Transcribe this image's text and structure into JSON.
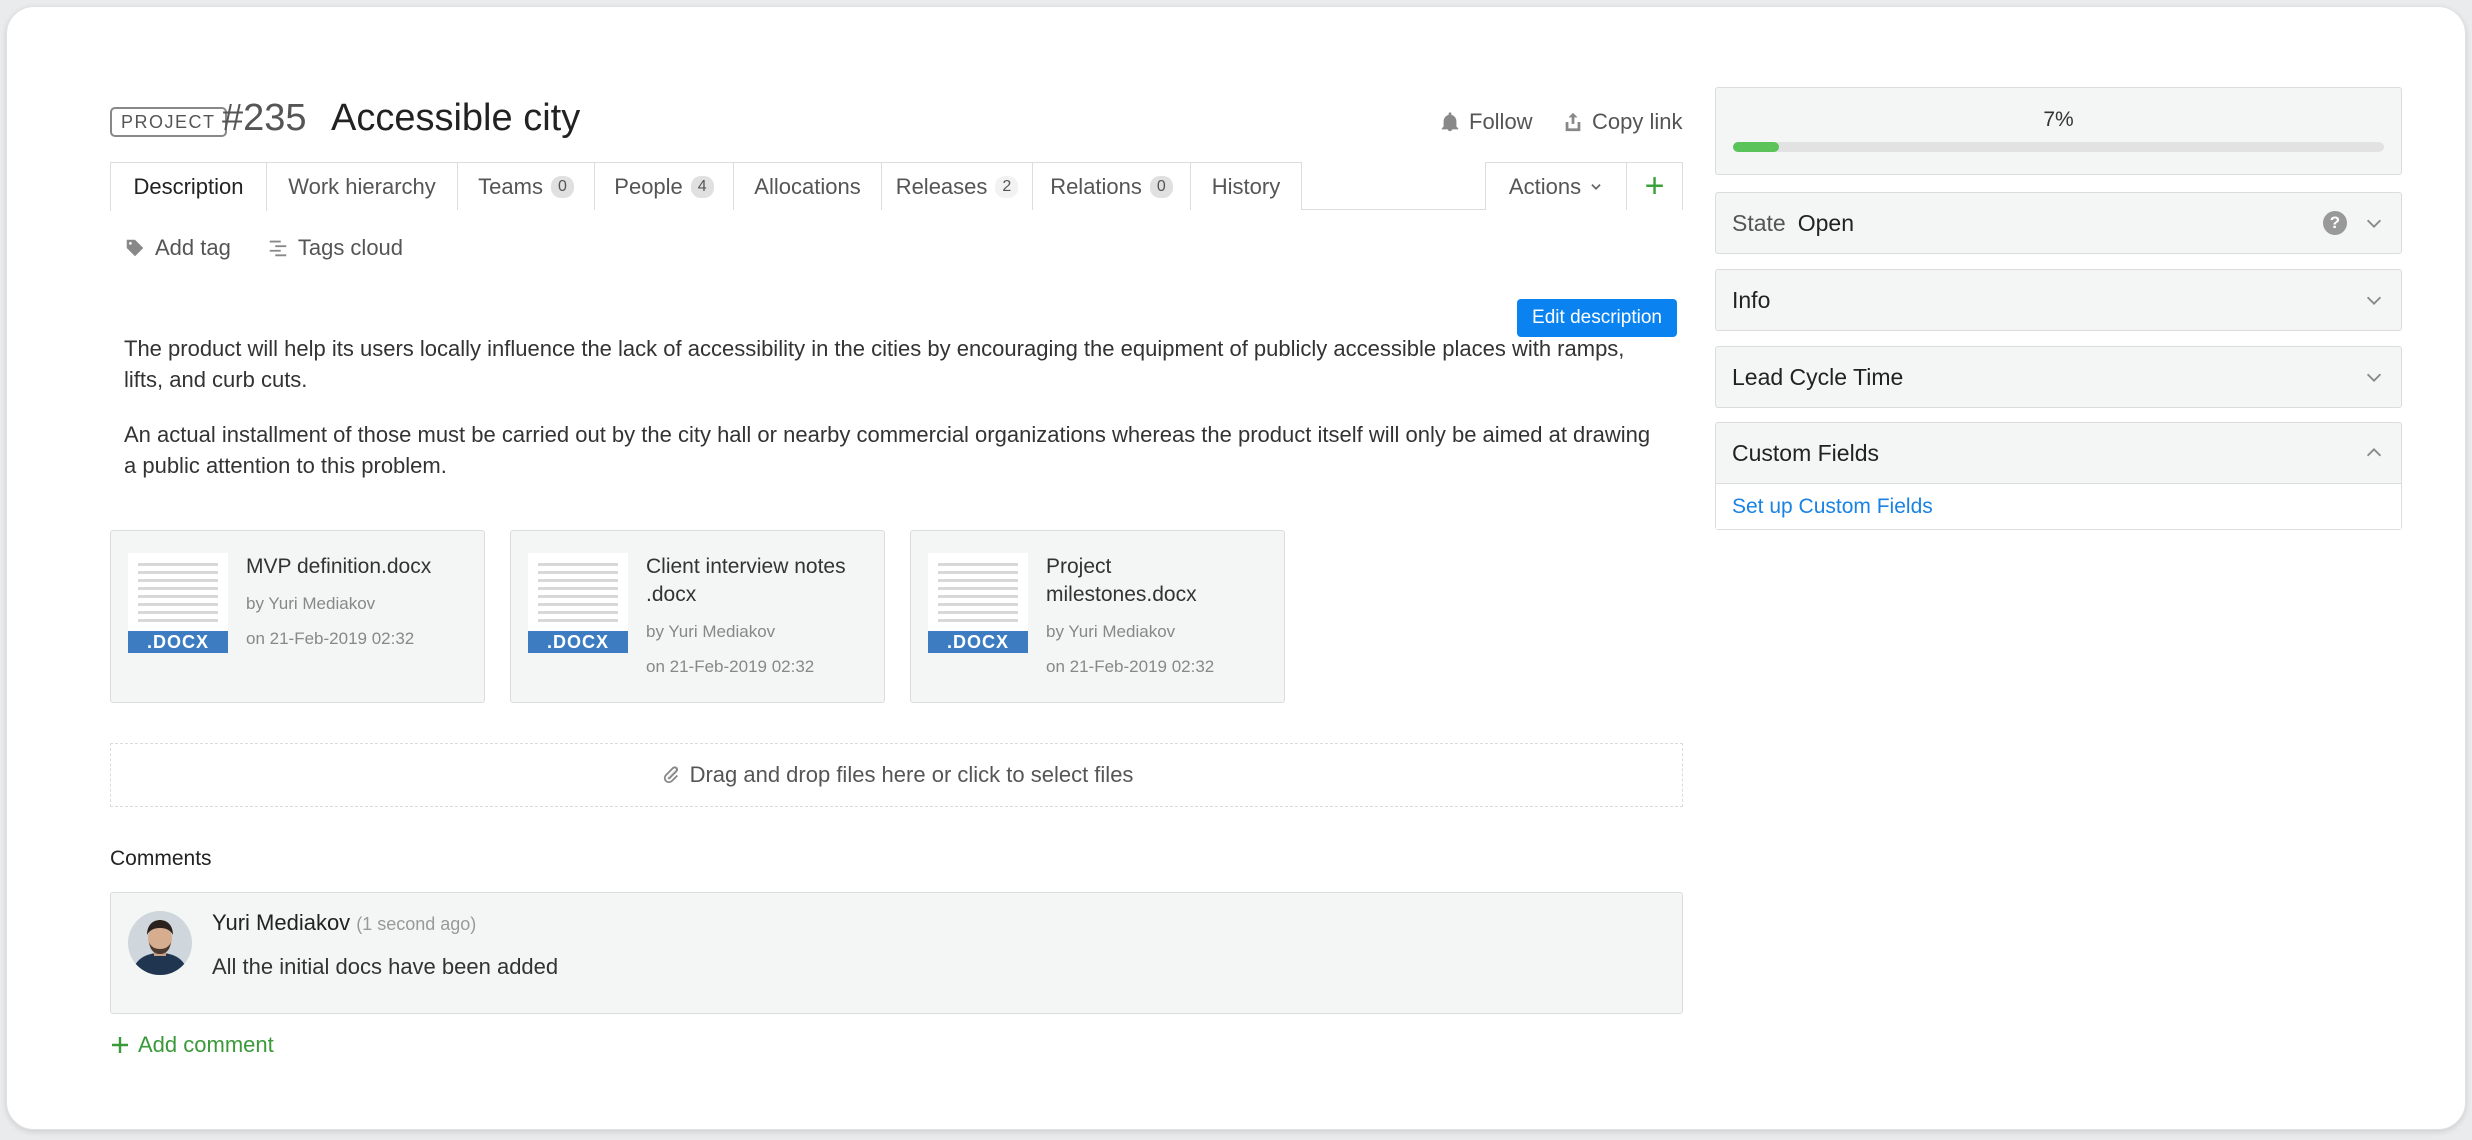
{
  "header": {
    "badge": "PROJECT",
    "number": "#235",
    "title": "Accessible city",
    "follow": "Follow",
    "copy_link": "Copy link"
  },
  "tabs": [
    {
      "label": "Description"
    },
    {
      "label": "Work hierarchy"
    },
    {
      "label": "Teams",
      "count": "0"
    },
    {
      "label": "People",
      "count": "4"
    },
    {
      "label": "Allocations"
    },
    {
      "label": "Releases",
      "count": "2"
    },
    {
      "label": "Relations",
      "count": "0"
    },
    {
      "label": "History"
    }
  ],
  "actions_label": "Actions",
  "add_symbol": "+",
  "tags": {
    "add_tag": "Add tag",
    "tags_cloud": "Tags cloud"
  },
  "edit_description": "Edit description",
  "description": [
    "The product will help its users locally influence the lack of accessibility in the cities by encouraging the equipment of publicly accessible places with ramps, lifts, and curb cuts.",
    "An actual installment of those must be carried out by the city hall or nearby commercial organizations whereas the product itself will only be aimed at drawing a public attention to this problem."
  ],
  "files": [
    {
      "name": "MVP definition.docx",
      "author": "by Yuri Mediakov",
      "date": "on 21-Feb-2019 02:32",
      "ext": ".DOCX"
    },
    {
      "name": "Client interview notes .docx",
      "author": "by Yuri Mediakov",
      "date": "on 21-Feb-2019 02:32",
      "ext": ".DOCX"
    },
    {
      "name": "Project milestones.docx",
      "author": "by Yuri Mediakov",
      "date": "on 21-Feb-2019 02:32",
      "ext": ".DOCX"
    }
  ],
  "dropzone": "Drag and drop files here or click to select files",
  "comments": {
    "title": "Comments",
    "items": [
      {
        "author": "Yuri Mediakov",
        "time": "(1 second ago)",
        "text": "All the initial docs have been added"
      }
    ],
    "add": "Add comment"
  },
  "sidebar": {
    "progress_label": "7%",
    "progress": 0.07,
    "state_label": "State",
    "state_value": "Open",
    "help": "?",
    "info": "Info",
    "lead_cycle_time": "Lead Cycle Time",
    "custom_fields": "Custom Fields",
    "setup_custom_fields": "Set up Custom Fields"
  },
  "colors": {
    "accent_blue": "#0a83f1",
    "progress_green": "#5ac35a",
    "link_blue": "#1a82e2",
    "add_green": "#3a9a3a",
    "docx_blue": "#3d7cc1"
  }
}
